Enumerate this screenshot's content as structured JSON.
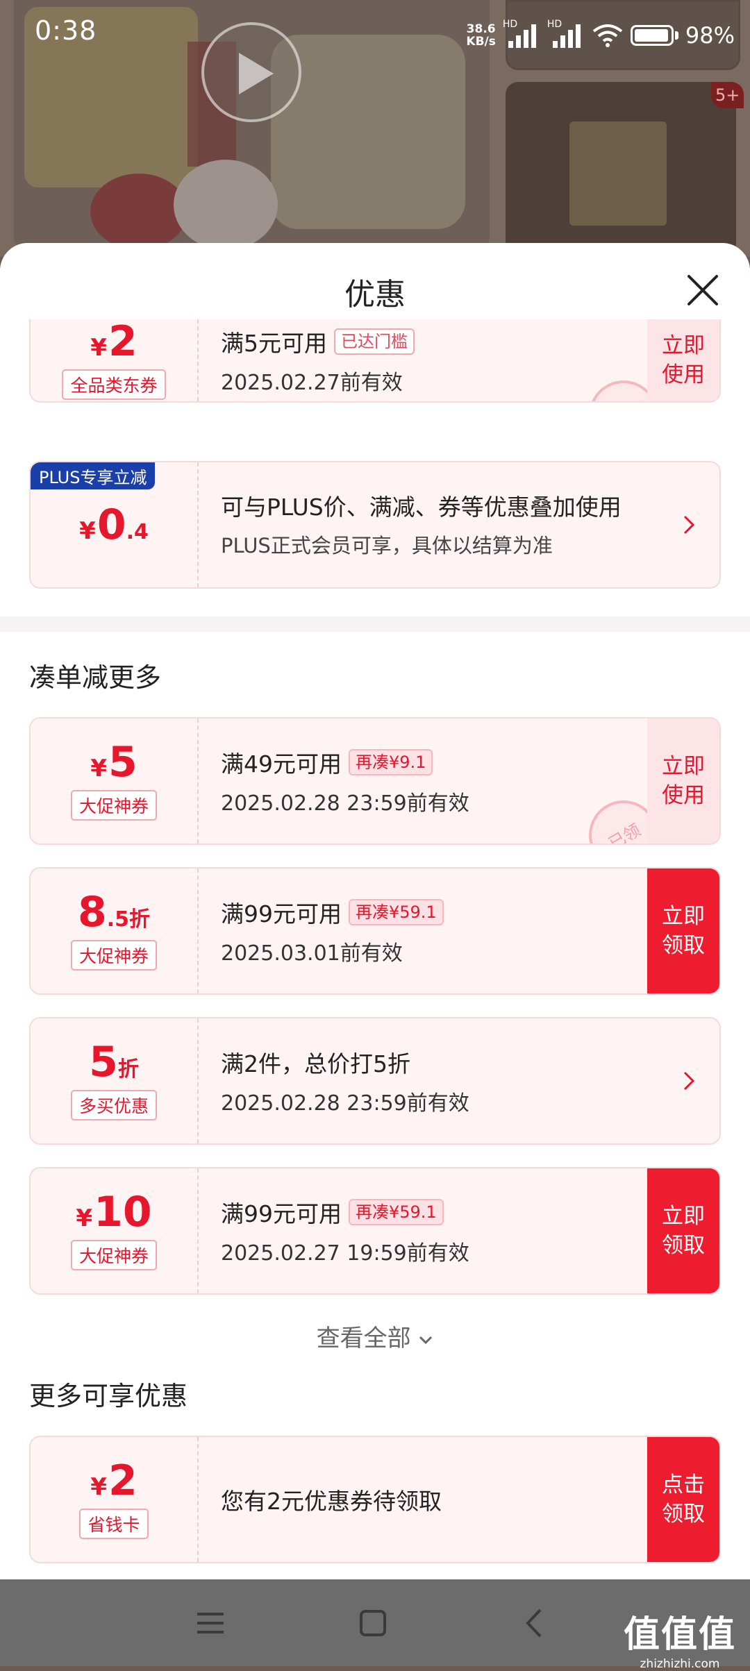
{
  "status": {
    "time": "0:38",
    "net_speed_value": "38.6",
    "net_speed_unit": "KB/s",
    "signal1_label": "HD",
    "signal2_label": "HD",
    "battery": "98%"
  },
  "background": {
    "thumb_badge": "5+"
  },
  "sheet": {
    "title": "优惠"
  },
  "top_coupons": [
    {
      "currency": "¥",
      "amount": "2",
      "tag": "全品类东券",
      "condition": "满5元可用",
      "badge": "已达门槛",
      "validity": "2025.02.27前有效",
      "action": [
        "立即",
        "使用"
      ],
      "stamp": "已领"
    },
    {
      "label": "PLUS专享立减",
      "currency": "¥",
      "amount_int": "0",
      "amount_dec": ".4",
      "line1": "可与PLUS价、满减、券等优惠叠加使用",
      "line2": "PLUS正式会员可享，具体以结算为准"
    }
  ],
  "section_combine": {
    "title": "凑单减更多",
    "coupons": [
      {
        "currency": "¥",
        "amount": "5",
        "tag": "大促神券",
        "condition": "满49元可用",
        "badge": "再凑¥9.1",
        "validity": "2025.02.28 23:59前有效",
        "action": [
          "立即",
          "使用"
        ],
        "stamp": "已领"
      },
      {
        "amount_int": "8",
        "amount_dec": ".5",
        "amount_unit": "折",
        "tag": "大促神券",
        "condition": "满99元可用",
        "badge": "再凑¥59.1",
        "validity": "2025.03.01前有效",
        "action": [
          "立即",
          "领取"
        ]
      },
      {
        "amount_int": "5",
        "amount_unit": "折",
        "tag": "多买优惠",
        "condition": "满2件，总价打5折",
        "validity": "2025.02.28 23:59前有效"
      },
      {
        "currency": "¥",
        "amount": "10",
        "tag": "大促神券",
        "condition": "满99元可用",
        "badge": "再凑¥59.1",
        "validity": "2025.02.27 19:59前有效",
        "action": [
          "立即",
          "领取"
        ]
      }
    ],
    "see_all": "查看全部"
  },
  "section_more": {
    "title": "更多可享优惠",
    "coupon": {
      "currency": "¥",
      "amount": "2",
      "tag": "省钱卡",
      "text": "您有2元优惠券待领取",
      "action": [
        "点击",
        "领取"
      ]
    }
  },
  "watermark": {
    "main": "值值值",
    "sub": "zhizhizhi.com"
  },
  "colors": {
    "accent_red": "#e6162d",
    "button_red": "#ee1c2f",
    "plus_blue": "#1a3fa8",
    "card_bg": "#fef4f4"
  }
}
